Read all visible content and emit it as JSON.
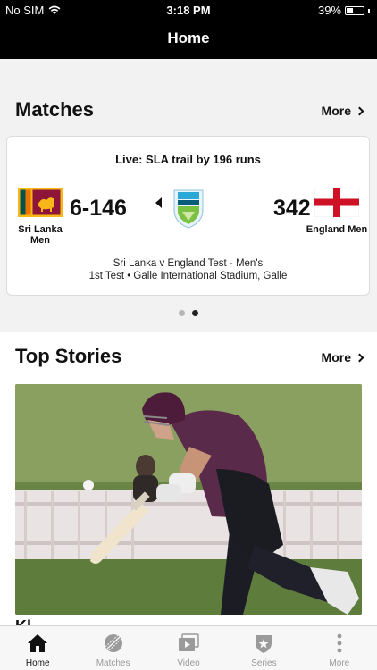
{
  "status": {
    "carrier": "No SIM",
    "time": "3:18 PM",
    "battery": "39%",
    "battery_level": 0.39
  },
  "header": {
    "title": "Home"
  },
  "matches": {
    "title": "Matches",
    "more": "More",
    "card": {
      "live": "Live: SLA trail by 196 runs",
      "home": {
        "name": "Sri Lanka Men",
        "score": "6-146"
      },
      "away": {
        "name": "England Men",
        "score": "342"
      },
      "description_line1": "Sri Lanka v England Test - Men's",
      "description_line2": "1st Test • Galle International Stadium, Galle"
    },
    "page_count": 2,
    "active_page": 2
  },
  "top_stories": {
    "title": "Top Stories",
    "more": "More",
    "headline_partial": "Kl..."
  },
  "tabs": [
    {
      "label": "Home",
      "icon": "home-icon",
      "active": true
    },
    {
      "label": "Matches",
      "icon": "cricket-ball-icon",
      "active": false
    },
    {
      "label": "Video",
      "icon": "video-icon",
      "active": false
    },
    {
      "label": "Series",
      "icon": "shield-star-icon",
      "active": false
    },
    {
      "label": "More",
      "icon": "more-dots-icon",
      "active": false
    }
  ]
}
